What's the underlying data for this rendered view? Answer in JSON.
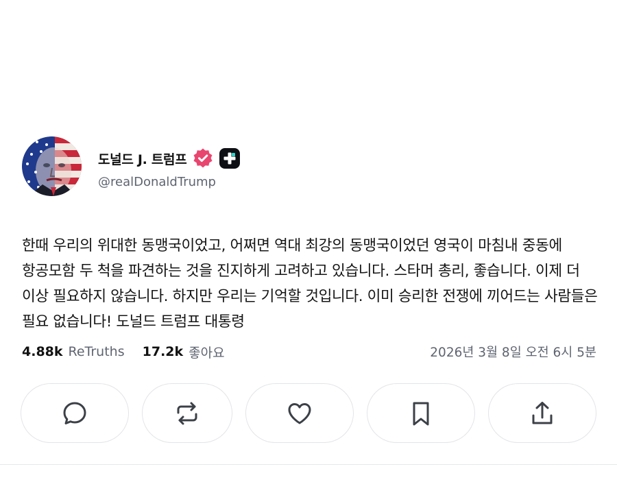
{
  "post": {
    "author": {
      "display_name": "도널드 J. 트럼프",
      "handle": "@realDonaldTrump",
      "avatar": "avatar-image",
      "verified_icon": "verified-badge-icon",
      "badge_icon": "truth-plus-icon"
    },
    "text": "한때 우리의 위대한 동맹국이었고, 어쩌면 역대 최강의 동맹국이었던 영국이 마침내 중동에 항공모함 두 척을 파견하는 것을 진지하게 고려하고 있습니다. 스타머 총리, 좋습니다. 이제 더 이상 필요하지 않습니다. 하지만 우리는 기억할 것입니다. 이미 승리한 전쟁에 끼어드는 사람들은 필요 없습니다! 도널드 트럼프 대통령",
    "stats": {
      "retruths_count": "4.88k",
      "retruths_label": "ReTruths",
      "likes_count": "17.2k",
      "likes_label": "좋아요"
    },
    "timestamp": "2026년 3월 8일 오전 6시 5분"
  },
  "actions": [
    {
      "name": "reply",
      "icon": "comment-icon"
    },
    {
      "name": "retruth",
      "icon": "repost-icon"
    },
    {
      "name": "like",
      "icon": "heart-icon"
    },
    {
      "name": "bookmark",
      "icon": "bookmark-icon"
    },
    {
      "name": "share",
      "icon": "share-icon"
    }
  ],
  "colors": {
    "verified_badge": "#e8466f",
    "muted_text": "#5e6470",
    "border": "#e3e4e8",
    "icon_stroke": "#3c4047"
  }
}
